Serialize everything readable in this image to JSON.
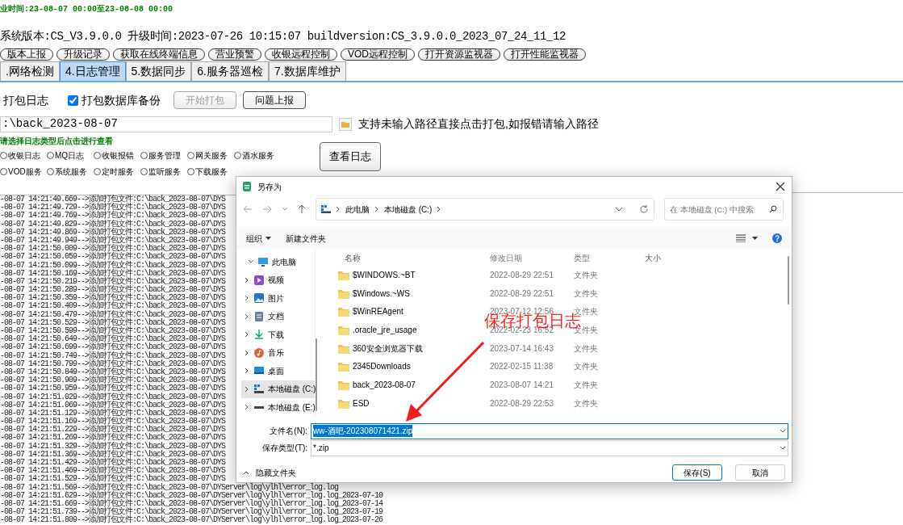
{
  "business_time": "业时间:23-08-07 00:00至23-08-08 00:00",
  "version_line": "系统版本:CS_V3.9.0.0 升级时间:2023-07-26 10:15:07 buildversion:CS_3.9.0.0_2023_07_24_11_12",
  "tool_buttons": [
    "版本上报",
    "升级记录",
    "获取在线终端信息",
    "营业预警",
    "收银远程控制",
    "VOD远程控制",
    "打开资源监视器",
    "打开性能监视器"
  ],
  "tabs": [
    {
      "label": ".网络检测",
      "selected": false
    },
    {
      "label": "4.日志管理",
      "selected": true
    },
    {
      "label": "5.数据同步",
      "selected": false
    },
    {
      "label": "6.服务器巡检",
      "selected": false
    },
    {
      "label": "7.数据库维护",
      "selected": false
    }
  ],
  "pack_log_label": "打包日志",
  "db_backup": {
    "label": "打包数据库备份",
    "checked": true
  },
  "action_buttons": [
    {
      "label": "开始打包",
      "disabled": true
    },
    {
      "label": "问题上报",
      "disabled": false
    }
  ],
  "path_field": {
    "value": ":\\back_2023-08-07"
  },
  "path_hint": "支持未输入路径直接点击打包,如报错请输入路径",
  "log_type_prompt": "请选择日志类型后点击进行查看",
  "log_types": [
    [
      {
        "label": "收银日志",
        "selected": false
      },
      {
        "label": "MQ日志",
        "selected": false
      },
      {
        "label": "收银报错",
        "selected": false
      },
      {
        "label": "服务管理",
        "selected": false
      },
      {
        "label": "网关服务",
        "selected": false
      },
      {
        "label": "酒水服务",
        "selected": false
      }
    ],
    [
      {
        "label": "VOD服务",
        "selected": false
      },
      {
        "label": "系统服务",
        "selected": false
      },
      {
        "label": "定时服务",
        "selected": false
      },
      {
        "label": "监听服务",
        "selected": false
      },
      {
        "label": "下载服务",
        "selected": false
      }
    ]
  ],
  "view_log_button": "查看日志",
  "log_lines": [
    "-08-07 14:21:49.669-->添加打包文件:C:\\back_2023-08-07\\DYS",
    "-08-07 14:21:49.729-->添加打包文件:C:\\back_2023-08-07\\DYS",
    "-08-07 14:21:49.769-->添加打包文件:C:\\back_2023-08-07\\DYS",
    "-08-07 14:21:49.829-->添加打包文件:C:\\back_2023-08-07\\DYS",
    "-08-07 14:21:49.869-->添加打包文件:C:\\back_2023-08-07\\DYS",
    "-08-07 14:21:49.949-->添加打包文件:C:\\back_2023-08-07\\DYS",
    "-08-07 14:21:50.009-->添加打包文件:C:\\back_2023-08-07\\DYS",
    "-08-07 14:21:50.059-->添加打包文件:C:\\back_2023-08-07\\DYS",
    "-08-07 14:21:50.099-->添加打包文件:C:\\back_2023-08-07\\DYS",
    "-08-07 14:21:50.169-->添加打包文件:C:\\back_2023-08-07\\DYS",
    "-08-07 14:21:50.219-->添加打包文件:C:\\back_2023-08-07\\DYS",
    "-08-07 14:21:50.289-->添加打包文件:C:\\back_2023-08-07\\DYS",
    "-08-07 14:21:50.359-->添加打包文件:C:\\back_2023-08-07\\DYS",
    "-08-07 14:21:50.409-->添加打包文件:C:\\back_2023-08-07\\DYS",
    "-08-07 14:21:50.479-->添加打包文件:C:\\back_2023-08-07\\DYS",
    "-08-07 14:21:50.529-->添加打包文件:C:\\back_2023-08-07\\DYS",
    "-08-07 14:21:50.599-->添加打包文件:C:\\back_2023-08-07\\DYS",
    "-08-07 14:21:50.649-->添加打包文件:C:\\back_2023-08-07\\DYS",
    "-08-07 14:21:50.699-->添加打包文件:C:\\back_2023-08-07\\DYS",
    "-08-07 14:21:50.749-->添加打包文件:C:\\back_2023-08-07\\DYS",
    "-08-07 14:21:50.799-->添加打包文件:C:\\back_2023-08-07\\DYS",
    "-08-07 14:21:50.849-->添加打包文件:C:\\back_2023-08-07\\DYS",
    "-08-07 14:21:50.909-->添加打包文件:C:\\back_2023-08-07\\DYS",
    "-08-07 14:21:50.959-->添加打包文件:C:\\back_2023-08-07\\DYS",
    "-08-07 14:21:51.029-->添加打包文件:C:\\back_2023-08-07\\DYS",
    "-08-07 14:21:51.069-->添加打包文件:C:\\back_2023-08-07\\DYS",
    "-08-07 14:21:51.129-->添加打包文件:C:\\back_2023-08-07\\DYS",
    "-08-07 14:21:51.169-->添加打包文件:C:\\back_2023-08-07\\DYS",
    "-08-07 14:21:51.229-->添加打包文件:C:\\back_2023-08-07\\DYS",
    "-08-07 14:21:51.269-->添加打包文件:C:\\back_2023-08-07\\DYS",
    "-08-07 14:21:51.329-->添加打包文件:C:\\back_2023-08-07\\DYS",
    "-08-07 14:21:51.369-->添加打包文件:C:\\back_2023-08-07\\DYS",
    "-08-07 14:21:51.429-->添加打包文件:C:\\back_2023-08-07\\DYS",
    "-08-07 14:21:51.469-->添加打包文件:C:\\back_2023-08-07\\DYS",
    "-08-07 14:21:51.529-->添加打包文件:C:\\back_2023-08-07\\DYS",
    "-08-07 14:21:51.569-->添加打包文件:C:\\back_2023-08-07\\DYServer\\log\\ylhl\\error_log.log",
    "-08-07 14:21:51.629-->添加打包文件:C:\\back_2023-08-07\\DYServer\\log\\ylhl\\error_log.log_2023-07-10",
    "-08-07 14:21:51.669-->添加打包文件:C:\\back_2023-08-07\\DYServer\\log\\ylhl\\error_log.log_2023-07-14",
    "-08-07 14:21:51.739-->添加打包文件:C:\\back_2023-08-07\\DYServer\\log\\ylhl\\error_log.log_2023-07-19",
    "-08-07 14:21:51.809-->添加打包文件:C:\\back_2023-08-07\\DYServer\\log\\ylhl\\error_log.log_2023-07-26"
  ],
  "dialog": {
    "title": "另存为",
    "breadcrumb": [
      "此电脑",
      "本地磁盘 (C:)"
    ],
    "search": {
      "placeholder": "在 本地磁盘 (C:) 中搜索"
    },
    "toolbar": [
      "组织",
      "新建文件夹"
    ],
    "nav": [
      {
        "label": "此电脑",
        "expanded": true,
        "selected": false,
        "children": [
          {
            "label": "视频",
            "expanded": false,
            "selected": false
          },
          {
            "label": "图片",
            "expanded": false,
            "selected": false
          },
          {
            "label": "文档",
            "expanded": false,
            "selected": false
          },
          {
            "label": "下载",
            "expanded": false,
            "selected": false
          },
          {
            "label": "音乐",
            "expanded": false,
            "selected": false
          },
          {
            "label": "桌面",
            "expanded": false,
            "selected": false
          },
          {
            "label": "本地磁盘 (C:)",
            "expanded": false,
            "selected": true
          },
          {
            "label": "本地磁盘 (E:)",
            "expanded": false,
            "selected": false
          }
        ]
      }
    ],
    "columns": [
      "名称",
      "修改日期",
      "类型",
      "大小"
    ],
    "files": [
      {
        "name": "$WINDOWS.~BT",
        "modified": "2022-08-29 22:51",
        "type": "文件夹"
      },
      {
        "name": "$Windows.~WS",
        "modified": "2022-08-29 22:51",
        "type": "文件夹"
      },
      {
        "name": "$WinREAgent",
        "modified": "2023-07-12 12:56",
        "type": "文件夹"
      },
      {
        "name": ".oracle_jre_usage",
        "modified": "2022-02-23 16:52",
        "type": "文件夹"
      },
      {
        "name": "360安全浏览器下载",
        "modified": "2023-07-14 16:43",
        "type": "文件夹"
      },
      {
        "name": "2345Downloads",
        "modified": "2022-02-15 11:38",
        "type": "文件夹"
      },
      {
        "name": "back_2023-08-07",
        "modified": "2023-08-07 14:21",
        "type": "文件夹"
      },
      {
        "name": "ESD",
        "modified": "2022-08-29 22:53",
        "type": "文件夹"
      }
    ],
    "filename_label": "文件名(N):",
    "filename": "ww-酒吧-202308071421.zip",
    "filetype_label": "保存类型(T):",
    "filetype": "*.zip",
    "hide_folders": "隐藏文件夹",
    "buttons": [
      "保存(S)",
      "取消"
    ]
  },
  "annotation": "保存打包日志"
}
